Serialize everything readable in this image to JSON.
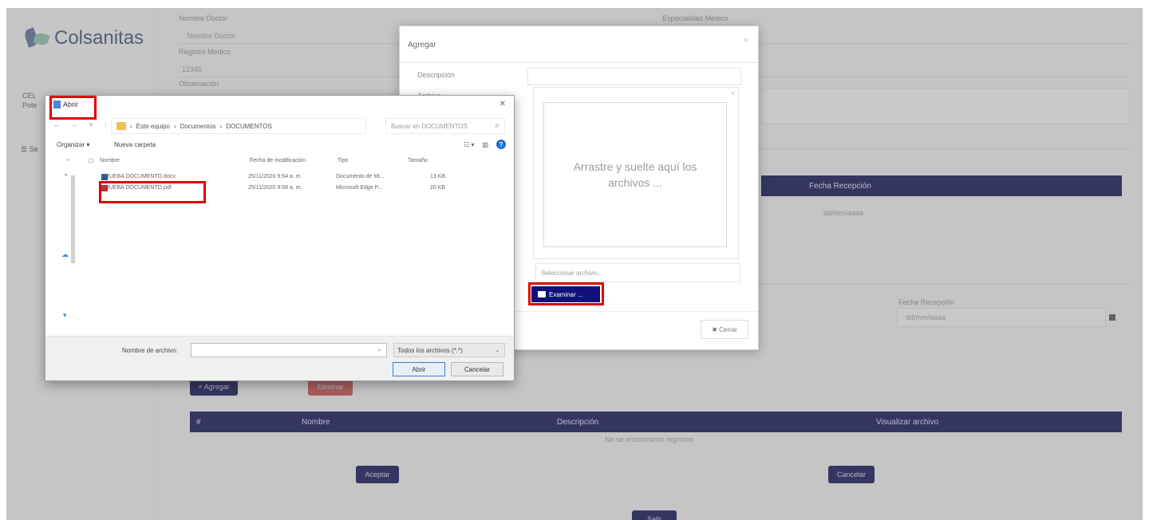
{
  "app": {
    "brand": "Colsanitas",
    "sidebar_user": "CEL",
    "sidebar_user2": "Pote",
    "sidebar_nav": "Se",
    "form": {
      "nombre_doctor_label": "Nombre Doctor",
      "nombre_doctor_value": "Nombre Doctor",
      "registro_label": "Registro Medico",
      "registro_value": "12345",
      "observacion_label": "Observación",
      "especialidad_label": "Especialidad Medico",
      "fecha_recepcion_label": "Fecha Recepción",
      "fecha_recepcion_value": "dd/mm/aaaa"
    },
    "upper_table": {
      "header": "Fecha Recepción",
      "cell": "dd/mm/aaaa"
    },
    "actions": {
      "agregar": "+ Agregar",
      "eliminar": "Eliminar"
    },
    "lower_table": {
      "columns": [
        "#",
        "Nombre",
        "Descripción",
        "Visualizar archivo"
      ],
      "empty_message": "No se encontraron registros"
    },
    "aceptar": "Aceptar",
    "cancelar": "Cancelar",
    "bottom_button": "Salir"
  },
  "modal": {
    "title": "Agregar",
    "close": "×",
    "description_label": "Descripción",
    "archivo_label": "Archivo",
    "drop_text": "Arrastre y suelte aquí los archivos ...",
    "file_placeholder": "Seleccionar archivo...",
    "browse_label": "Examinar ...",
    "cerrar_label": "✖ Cerrar"
  },
  "file_dialog": {
    "title": "Abrir",
    "close": "✕",
    "nav_arrows": "← → ˅ ↑",
    "breadcrumb": [
      "Este equipo",
      "Documentos",
      "DOCUMENTOS"
    ],
    "search_placeholder": "Buscar en DOCUMENTOS",
    "organize": "Organizar ▾",
    "new_folder": "Nueva carpeta",
    "columns": [
      "Nombre",
      "Fecha de modificación",
      "Tipo",
      "Tamaño"
    ],
    "files": [
      {
        "name": "PRUEBA DOCUMENTO.docx",
        "date": "25/11/2020 9:54 a. m.",
        "type": "Documento de Mi...",
        "size": "13 KB",
        "icon_color": "#2b579a"
      },
      {
        "name": "PRUEBA DOCUMENTO.pdf",
        "date": "25/11/2020 9:56 a. m.",
        "type": "Microsoft Edge P...",
        "size": "20 KB",
        "icon_color": "#c8282e"
      }
    ],
    "filename_label": "Nombre de archivo:",
    "filename_value": "",
    "filter_label": "Todos los archivos (*.*)",
    "open_button": "Abrir",
    "cancel_button": "Cancelar"
  }
}
